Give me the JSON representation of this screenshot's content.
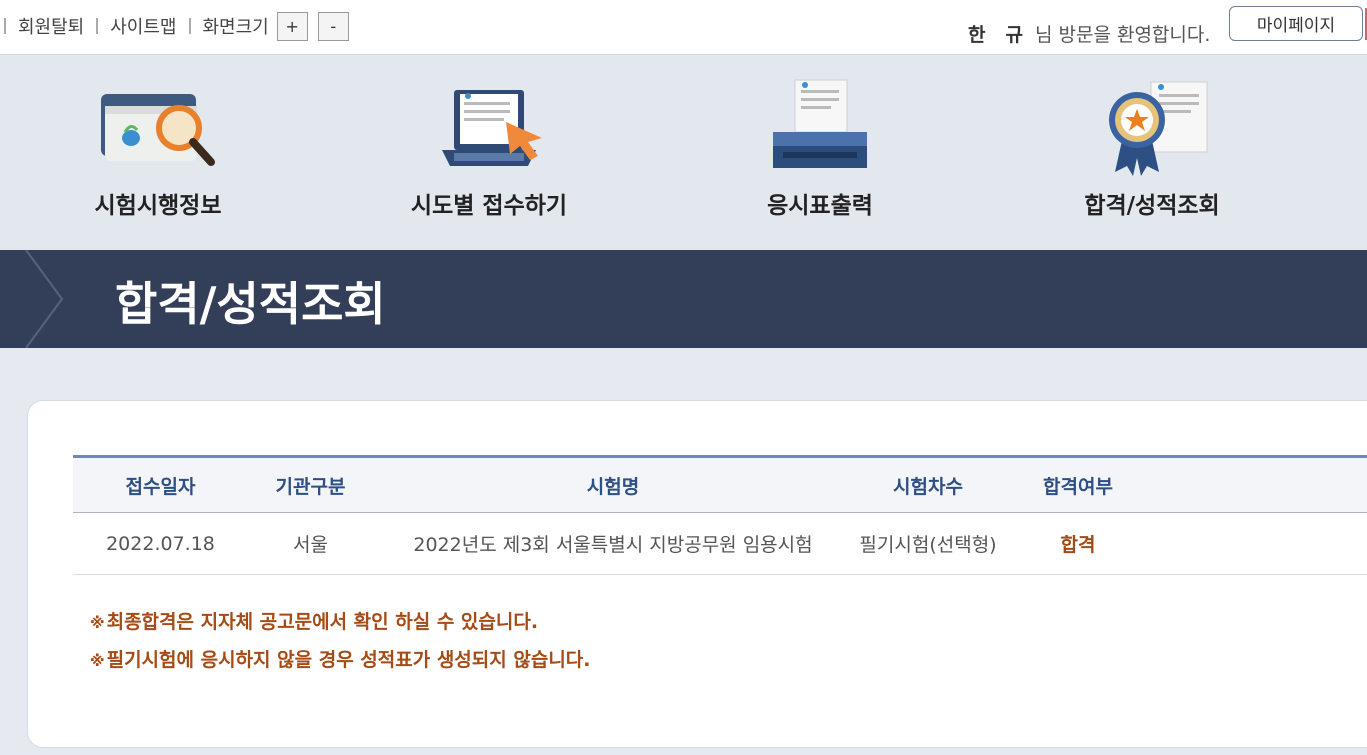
{
  "topbar": {
    "withdraw_label": "회원탈퇴",
    "sitemap_label": "사이트맵",
    "zoom_label": "화면크기",
    "zoom_in": "+",
    "zoom_out": "-",
    "user_name_first": "한",
    "user_name_last": "규",
    "welcome_text": "님 방문을 환영합니다.",
    "mypage_label": "마이페이지"
  },
  "menu": {
    "items": [
      {
        "label": "시험시행정보",
        "icon": "folder-search-icon"
      },
      {
        "label": "시도별 접수하기",
        "icon": "laptop-cursor-icon"
      },
      {
        "label": "응시표출력",
        "icon": "printer-icon"
      },
      {
        "label": "합격/성적조회",
        "icon": "award-ribbon-icon"
      }
    ]
  },
  "banner": {
    "title": "합격/성적조회"
  },
  "table": {
    "headers": [
      "접수일자",
      "기관구분",
      "시험명",
      "시험차수",
      "합격여부"
    ],
    "rows": [
      [
        "2022.07.18",
        "서울",
        "2022년도 제3회 서울특별시 지방공무원 임용시험",
        "필기시험(선택형)",
        "합격"
      ]
    ]
  },
  "notes": [
    "최종합격은 지자체 공고문에서 확인 하실 수 있습니다.",
    "필기시험에 응시하지 않을 경우 성적표가 생성되지 않습니다."
  ],
  "note_mark": "※",
  "colors": {
    "banner_bg": "#333f58",
    "header_text": "#2d4f84",
    "pass_text": "#a04a14",
    "note_text": "#a54b15"
  }
}
